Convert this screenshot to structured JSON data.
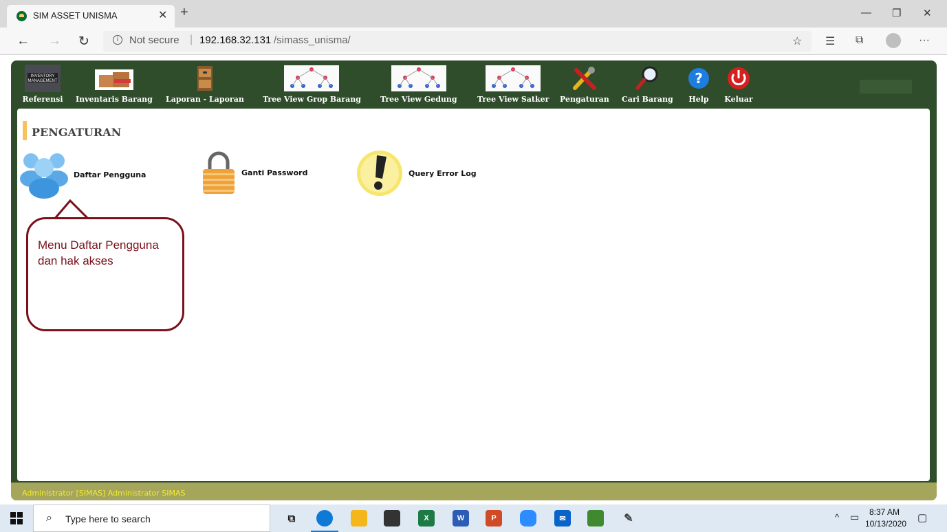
{
  "browser": {
    "tab_title": "SIM ASSET UNISMA",
    "not_secure": "Not secure",
    "url_host": "192.168.32.131",
    "url_path": "/simass_unisma/"
  },
  "toolbar": {
    "items": [
      {
        "label": "Referensi",
        "icon": "inventory-management-icon"
      },
      {
        "label": "Inventaris Barang",
        "icon": "boxes-icon"
      },
      {
        "label": "Laporan - Laporan",
        "icon": "file-cabinet-icon"
      },
      {
        "label": "Tree View Grop Barang",
        "icon": "tree-diagram-icon"
      },
      {
        "label": "Tree View Gedung",
        "icon": "tree-diagram-icon"
      },
      {
        "label": "Tree View Satker",
        "icon": "tree-diagram-icon"
      },
      {
        "label": "Pengaturan",
        "icon": "tools-icon"
      },
      {
        "label": "Cari Barang",
        "icon": "magnifier-icon"
      },
      {
        "label": "Help",
        "icon": "help-icon"
      },
      {
        "label": "Keluar",
        "icon": "power-icon"
      }
    ]
  },
  "main": {
    "page_title": "PENGATURAN",
    "menu": [
      {
        "label": "Daftar Pengguna",
        "icon": "users-icon"
      },
      {
        "label": "Ganti Password",
        "icon": "padlock-icon"
      },
      {
        "label": "Query Error Log",
        "icon": "warning-icon"
      }
    ],
    "callout_line1": "Menu Daftar Pengguna",
    "callout_line2": "dan hak akses"
  },
  "footer": {
    "user_text": "Administrator [SIMAS] Administrator SIMAS"
  },
  "taskbar": {
    "search_placeholder": "Type here to search",
    "time": "8:37 AM",
    "date": "10/13/2020"
  },
  "colors": {
    "frame_green": "#2f4d2b",
    "footer_olive": "#a6a55c",
    "footer_text": "#f0ec34",
    "callout_maroon": "#7a1019",
    "title_accent": "#f8c15a"
  }
}
